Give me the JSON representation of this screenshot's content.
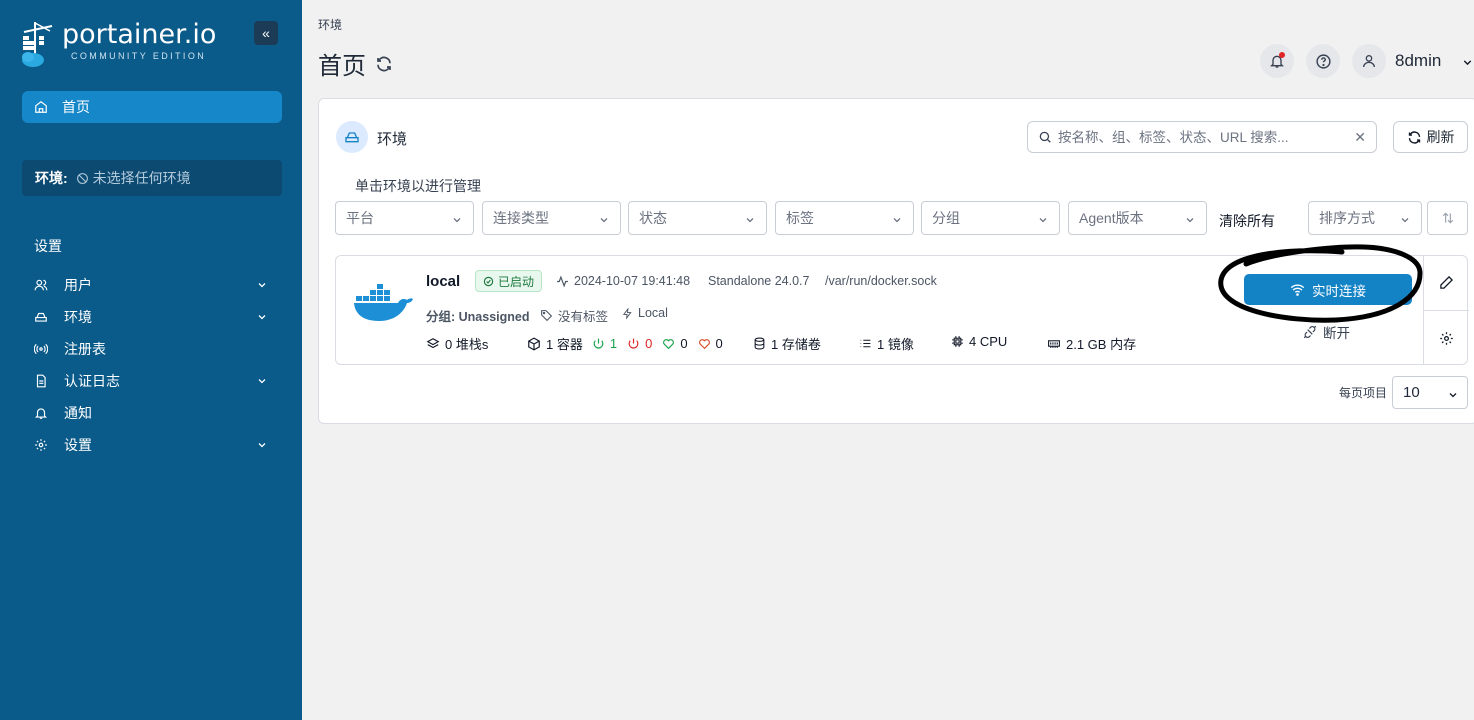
{
  "sidebar": {
    "logo_title": "portainer.io",
    "logo_subtitle": "COMMUNITY EDITION",
    "collapse_icon": "«",
    "home_label": "首页",
    "env_label": "环境:",
    "env_value": "未选择任何环境",
    "settings_heading": "设置",
    "items": [
      {
        "label": "用户",
        "icon": "users-icon",
        "expandable": true
      },
      {
        "label": "环境",
        "icon": "environment-icon",
        "expandable": true
      },
      {
        "label": "注册表",
        "icon": "registry-icon",
        "expandable": false
      },
      {
        "label": "认证日志",
        "icon": "logs-icon",
        "expandable": true
      },
      {
        "label": "通知",
        "icon": "bell-icon",
        "expandable": false
      },
      {
        "label": "设置",
        "icon": "gear-icon",
        "expandable": true
      }
    ]
  },
  "header": {
    "breadcrumb": "环境",
    "title": "首页",
    "username": "8dmin"
  },
  "card": {
    "title": "环境",
    "search_placeholder": "按名称、组、标签、状态、URL 搜索...",
    "refresh_label": "刷新",
    "hint": "单击环境以进行管理",
    "filters": [
      "平台",
      "连接类型",
      "状态",
      "标签",
      "分组",
      "Agent版本"
    ],
    "clear_all": "清除所有",
    "sort_label": "排序方式",
    "per_page_label": "每页项目",
    "per_page_value": "10"
  },
  "environment": {
    "name": "local",
    "status": "已启动",
    "heartbeat": "2024-10-07 19:41:48",
    "version": "Standalone 24.0.7",
    "url": "/var/run/docker.sock",
    "group": "分组: Unassigned",
    "tags": "没有标签",
    "type": "Local",
    "stacks": "0 堆栈s",
    "containers": "1 容器",
    "running": "1",
    "stopped": "0",
    "healthy": "0",
    "unhealthy": "0",
    "volumes": "1 存储卷",
    "images": "1 镜像",
    "cpu": "4 CPU",
    "memory": "2.1 GB 内存",
    "live_connect": "实时连接",
    "disconnect": "断开"
  },
  "colors": {
    "sidebar_bg": "#0a5a8a",
    "accent": "#1483c6",
    "success": "#16a34a",
    "danger": "#dc2626"
  }
}
